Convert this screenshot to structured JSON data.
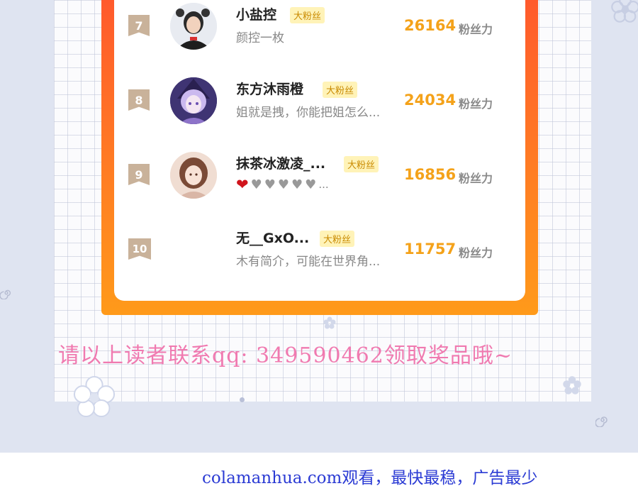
{
  "rows": [
    {
      "rank": "7",
      "name": "小盐控",
      "badge": "大粉丝",
      "desc": "颜控一枚",
      "score": "26164",
      "unit": "粉丝力",
      "avatar": "avatar-girl-red-icon"
    },
    {
      "rank": "8",
      "name": "东方沐雨橙",
      "badge": "大粉丝",
      "desc": "姐就是拽，你能把姐怎么...",
      "score": "24034",
      "unit": "粉丝力",
      "avatar": "avatar-anime-witch-icon"
    },
    {
      "rank": "9",
      "name": "抹茶冰激凌_...",
      "badge": "大粉丝",
      "hearts": "...",
      "score": "16856",
      "unit": "粉丝力",
      "avatar": "avatar-anime-girl-icon"
    },
    {
      "rank": "10",
      "name": "无__GxO...",
      "badge": "大粉丝",
      "desc": "木有简介，可能在世界角...",
      "score": "11757",
      "unit": "粉丝力",
      "avatar": ""
    }
  ],
  "promo_text": "请以上读者联系qq: 349590462领取奖品哦~",
  "footer_text": "colamanhua.com观看，最快最稳，广告最少",
  "colors": {
    "frame_start": "#ff5a2c",
    "frame_end": "#ff9a1a",
    "score": "#f4a21a",
    "badge_bg": "#fff3b8",
    "promo": "#f07ab0",
    "footer": "#2b3bd4"
  }
}
